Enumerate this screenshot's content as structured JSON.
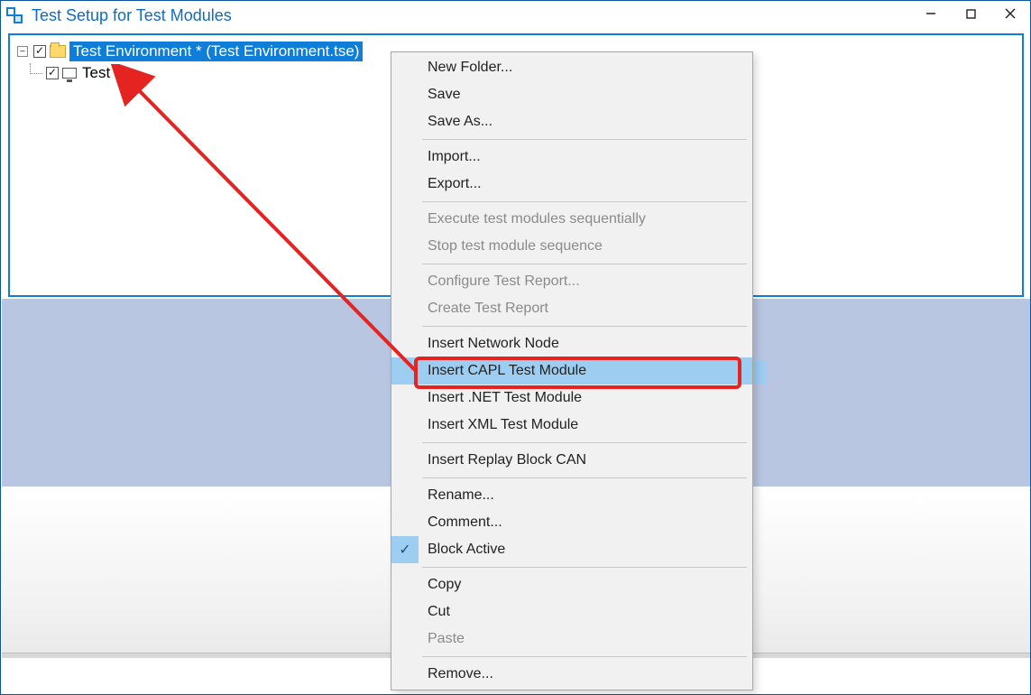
{
  "window": {
    "title": "Test Setup for Test Modules"
  },
  "tree": {
    "root_label": "Test Environment *  (Test Environment.tse)",
    "child_label": "Test 3"
  },
  "context_menu": {
    "new_folder": "New Folder...",
    "save": "Save",
    "save_as": "Save As...",
    "import": "Import...",
    "export": "Export...",
    "exec_seq": "Execute test modules sequentially",
    "stop_seq": "Stop test module sequence",
    "config_report": "Configure Test Report...",
    "create_report": "Create Test Report",
    "insert_network_node": "Insert Network Node",
    "insert_capl": "Insert CAPL Test Module",
    "insert_dotnet": "Insert .NET Test Module",
    "insert_xml": "Insert XML Test Module",
    "insert_replay": "Insert Replay Block CAN",
    "rename": "Rename...",
    "comment": "Comment...",
    "block_active": "Block Active",
    "copy": "Copy",
    "cut": "Cut",
    "paste": "Paste",
    "remove": "Remove..."
  }
}
